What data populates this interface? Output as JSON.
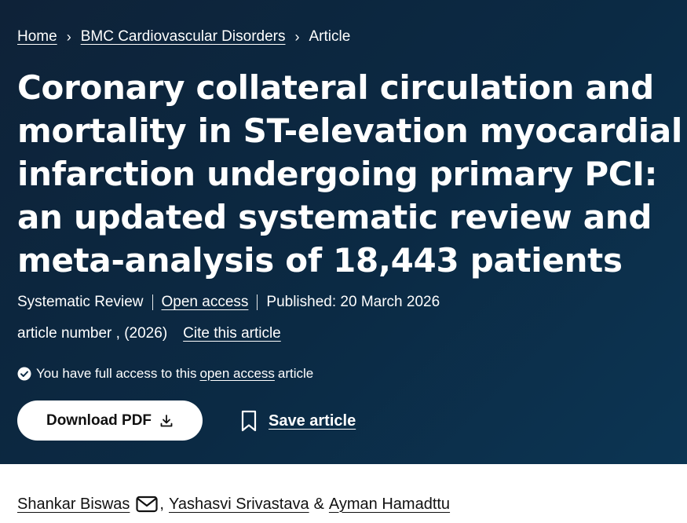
{
  "breadcrumb": {
    "home": "Home",
    "journal": "BMC Cardiovascular Disorders",
    "current": "Article",
    "separator": "›"
  },
  "article": {
    "title": "Coronary collateral circulation and mortality in ST-elevation myocardial infarction undergoing primary PCI: an updated systematic review and meta-analysis of 18,443 patients",
    "type": "Systematic Review",
    "access_link": "Open access",
    "published": "Published: 20 March 2026",
    "article_number": "article number , (2026)",
    "cite_link": "Cite this article"
  },
  "access_notice": {
    "prefix": "You have full access to this",
    "link": "open access",
    "suffix": "article"
  },
  "actions": {
    "download_label": "Download PDF",
    "save_label": "Save article"
  },
  "authors": {
    "first": "Shankar Biswas",
    "comma": ",",
    "second": "Yashasvi Srivastava",
    "amp": "&",
    "third": "Ayman Hamadttu"
  },
  "colors": {
    "hero_background": "#0b2a44",
    "button_background": "#ffffff",
    "text_on_dark": "#ffffff",
    "text_on_light": "#111111"
  },
  "icons": [
    "chevron-right-icon",
    "check-circle-icon",
    "download-icon",
    "bookmark-icon",
    "mail-icon"
  ]
}
